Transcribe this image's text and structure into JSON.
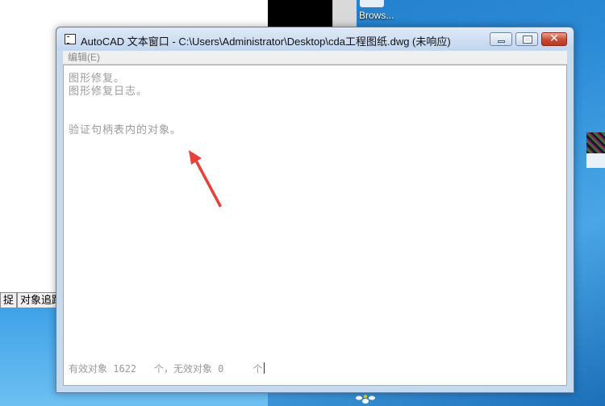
{
  "background_app": {
    "status_buttons": [
      "捉",
      "对象追踪"
    ]
  },
  "desktop": {
    "icon_label": "Brows..."
  },
  "window": {
    "title": "AutoCAD 文本窗口 - C:\\Users\\Administrator\\Desktop\\cda工程图纸.dwg (未响应)",
    "menu": {
      "edit_label": "编辑(E)"
    },
    "log_lines": [
      "图形修复。",
      "图形修复日志。",
      "验证句柄表内的对象。"
    ],
    "status": {
      "valid_label": "有效对象",
      "valid_count": "1622",
      "unit1": "个，",
      "invalid_label": "无效对象",
      "invalid_count": "0",
      "unit2": "个"
    },
    "buttons": {
      "minimize": "minimize",
      "maximize": "maximize",
      "close_glyph": "✕"
    }
  },
  "annotation": {
    "arrow_color": "#e8413c"
  },
  "colors": {
    "log_text": "#9a9a9a",
    "close_button": "#c64a32",
    "desktop": "#2a8ad6"
  }
}
